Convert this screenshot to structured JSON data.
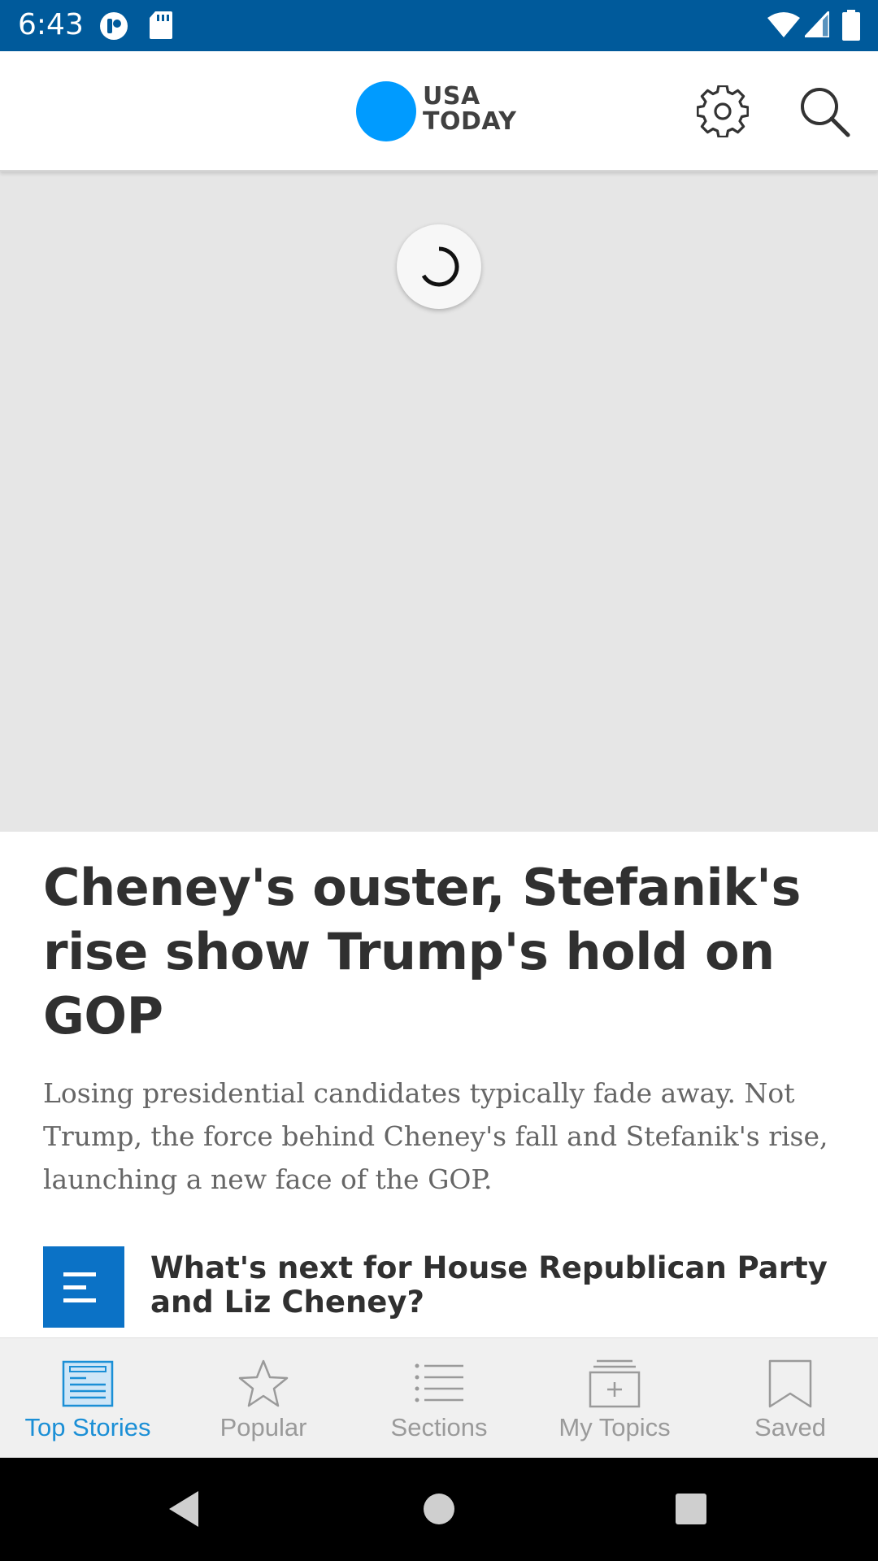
{
  "status_bar": {
    "time": "6:43"
  },
  "header": {
    "logo_line1": "USA",
    "logo_line2": "TODAY"
  },
  "article": {
    "headline": "Cheney's ouster, Stefanik's rise show Trump's hold on GOP",
    "summary": "Losing presidential candidates typically fade away. Not Trump, the force behind Cheney's fall and Stefanik's rise, launching a new face of the GOP.",
    "related_title": "What's next for House Republican Party and Liz Cheney?"
  },
  "bottom_nav": {
    "items": [
      {
        "label": "Top Stories",
        "icon": "top-stories-icon",
        "active": true
      },
      {
        "label": "Popular",
        "icon": "star-icon",
        "active": false
      },
      {
        "label": "Sections",
        "icon": "list-icon",
        "active": false
      },
      {
        "label": "My Topics",
        "icon": "my-topics-icon",
        "active": false
      },
      {
        "label": "Saved",
        "icon": "bookmark-icon",
        "active": false
      }
    ]
  },
  "colors": {
    "status_bar": "#005a9b",
    "brand_blue": "#009bff",
    "active_nav": "#1b8fd6",
    "related_icon_bg": "#0b72c6"
  }
}
